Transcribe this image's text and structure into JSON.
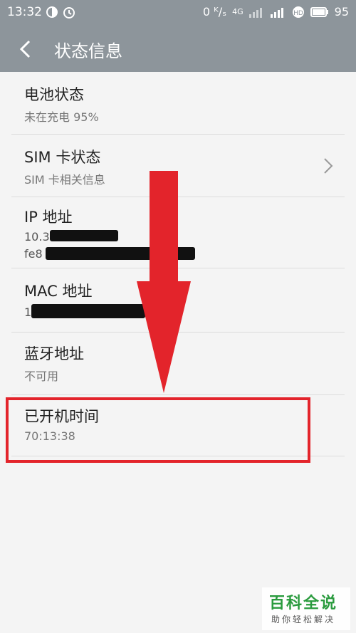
{
  "status_bar": {
    "time": "13:32",
    "net_speed": "0 ᴷ/ₛ",
    "net_type": "4G",
    "battery": "95"
  },
  "toolbar": {
    "back_icon": "chevron-left-icon",
    "title": "状态信息"
  },
  "items": [
    {
      "title": "电池状态",
      "subtitle": "未在充电 95%"
    },
    {
      "title": "SIM 卡状态",
      "subtitle": "SIM 卡相关信息",
      "chevron": "chevron-right-icon"
    },
    {
      "title": "IP 地址",
      "line1_prefix": "10.3",
      "line2_prefix": "fe8"
    },
    {
      "title": "MAC 地址",
      "line1_prefix": "1"
    },
    {
      "title": "蓝牙地址",
      "subtitle": "不可用"
    },
    {
      "title": "已开机时间",
      "subtitle": "70:13:38"
    }
  ],
  "annotation": {
    "arrow_color": "#e3242b",
    "highlight_color": "#e3242b"
  },
  "watermark": {
    "main": "百科全说",
    "sub": "助你轻松解决"
  }
}
